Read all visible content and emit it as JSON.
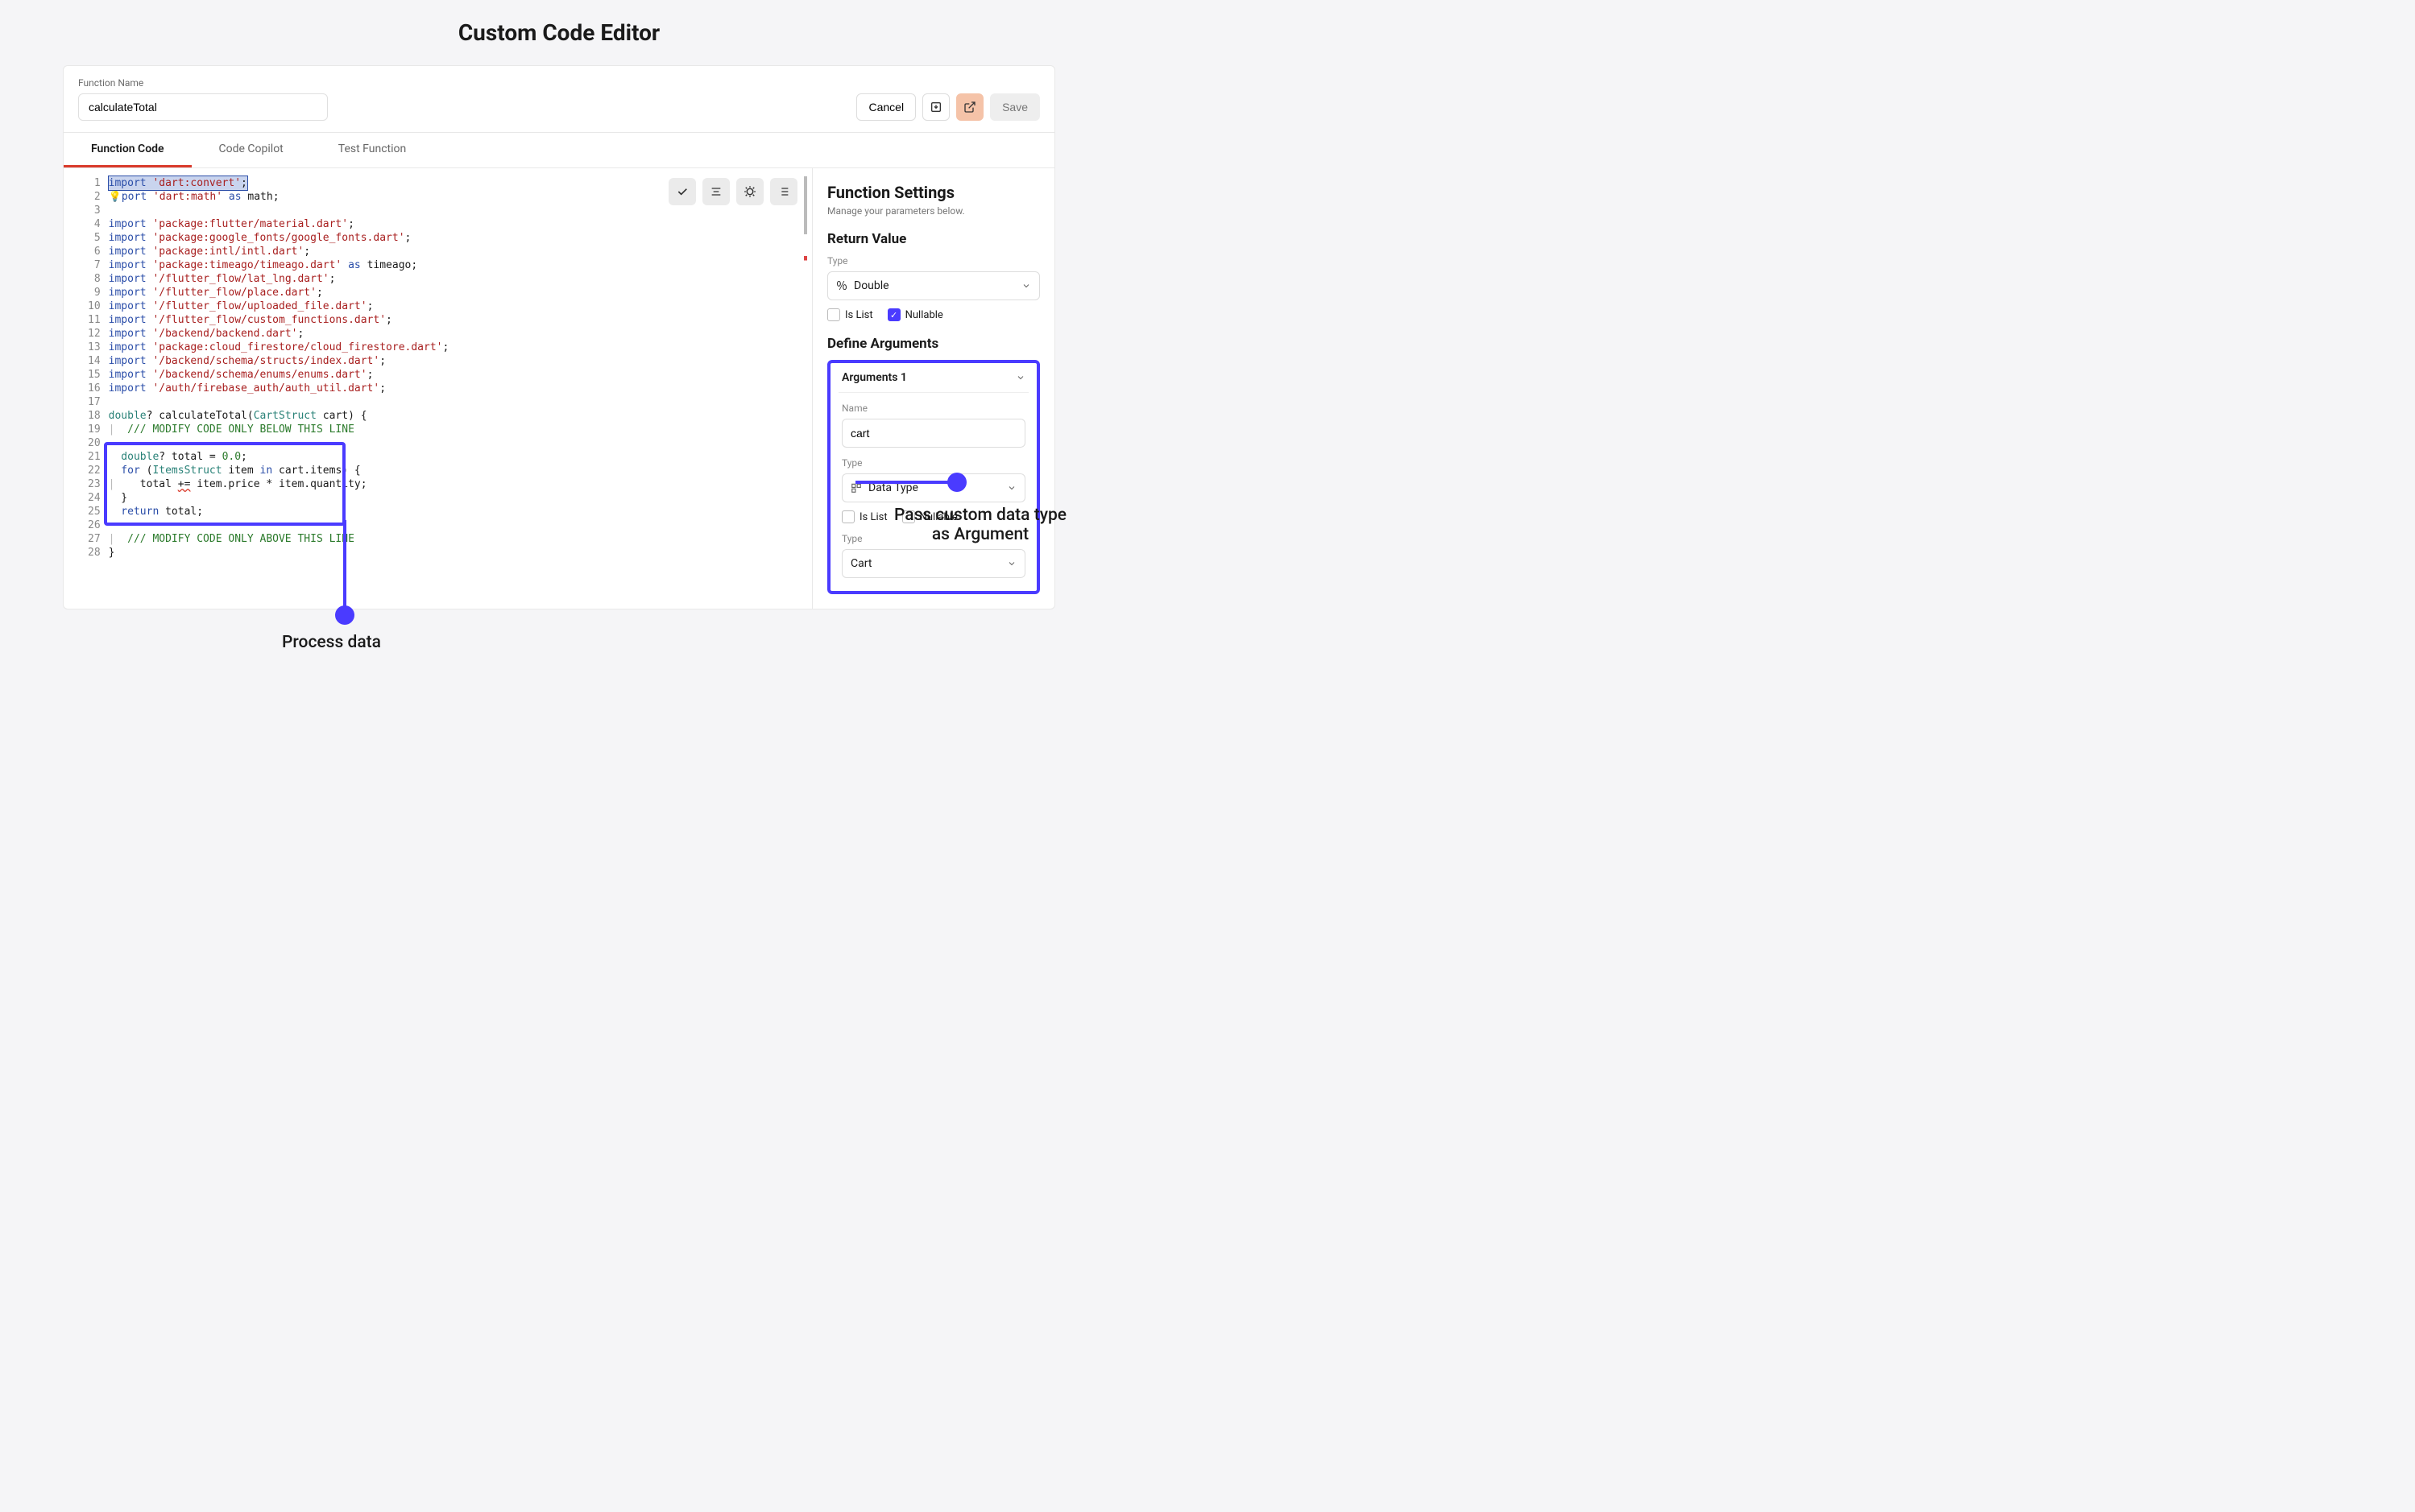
{
  "pageTitle": "Custom Code Editor",
  "header": {
    "fnNameLabel": "Function Name",
    "fnName": "calculateTotal",
    "cancel": "Cancel",
    "save": "Save"
  },
  "tabs": {
    "code": "Function Code",
    "copilot": "Code Copilot",
    "test": "Test Function"
  },
  "code": {
    "lines": [
      "1",
      "2",
      "3",
      "4",
      "5",
      "6",
      "7",
      "8",
      "9",
      "10",
      "11",
      "12",
      "13",
      "14",
      "15",
      "16",
      "17",
      "18",
      "19",
      "20",
      "21",
      "22",
      "23",
      "24",
      "25",
      "26",
      "27",
      "28"
    ],
    "l1_a": "import",
    "l1_b": "'dart:convert'",
    "l1_c": ";",
    "l2_a": "port",
    "l2_b": "'dart:math'",
    "l2_c": " as ",
    "l2_d": "math;",
    "l4_a": "import",
    "l4_b": "'package:flutter/material.dart'",
    "l4_c": ";",
    "l5_a": "import",
    "l5_b": "'package:google_fonts/google_fonts.dart'",
    "l5_c": ";",
    "l6_a": "import",
    "l6_b": "'package:intl/intl.dart'",
    "l6_c": ";",
    "l7_a": "import",
    "l7_b": "'package:timeago/timeago.dart'",
    "l7_c": " as ",
    "l7_d": "timeago;",
    "l8_a": "import",
    "l8_b": "'/flutter_flow/lat_lng.dart'",
    "l8_c": ";",
    "l9_a": "import",
    "l9_b": "'/flutter_flow/place.dart'",
    "l9_c": ";",
    "l10_a": "import",
    "l10_b": "'/flutter_flow/uploaded_file.dart'",
    "l10_c": ";",
    "l11_a": "import",
    "l11_b": "'/flutter_flow/custom_functions.dart'",
    "l11_c": ";",
    "l12_a": "import",
    "l12_b": "'/backend/backend.dart'",
    "l12_c": ";",
    "l13_a": "import",
    "l13_b": "'package:cloud_firestore/cloud_firestore.dart'",
    "l13_c": ";",
    "l14_a": "import",
    "l14_b": "'/backend/schema/structs/index.dart'",
    "l14_c": ";",
    "l15_a": "import",
    "l15_b": "'/backend/schema/enums/enums.dart'",
    "l15_c": ";",
    "l16_a": "import",
    "l16_b": "'/auth/firebase_auth/auth_util.dart'",
    "l16_c": ";",
    "l18_a": "double",
    "l18_b": "? calculateTotal(",
    "l18_c": "CartStruct",
    "l18_d": " cart) {",
    "l19": "  /// MODIFY CODE ONLY BELOW THIS LINE",
    "l21_a": "  double",
    "l21_b": "? total = ",
    "l21_c": "0.0",
    "l21_d": ";",
    "l22_a": "  for",
    "l22_b": " (",
    "l22_c": "ItemsStruct",
    "l22_d": " item ",
    "l22_e": "in",
    "l22_f": " cart.items) {",
    "l23_a": "    total ",
    "l23_b": "+=",
    "l23_c": " item.price * item.quantity;",
    "l24": "  }",
    "l25_a": "  return",
    "l25_b": " total;",
    "l27": "  /// MODIFY CODE ONLY ABOVE THIS LINE",
    "l28": "}",
    "pipe": "|"
  },
  "sidebar": {
    "title": "Function Settings",
    "sub": "Manage your parameters below.",
    "returnValue": "Return Value",
    "typeLabel": "Type",
    "returnType": "Double",
    "isList": "Is List",
    "nullable": "Nullable",
    "defineArgs": "Define Arguments",
    "argTitle": "Arguments 1",
    "nameLabel": "Name",
    "argName": "cart",
    "argType": "Data Type",
    "argType2": "Cart"
  },
  "annotations": {
    "left": "Process data",
    "right1": "Pass custom data type",
    "right2": "as Argument"
  },
  "icons": {
    "percent": "％",
    "check": "✓",
    "bulb": "💡"
  }
}
